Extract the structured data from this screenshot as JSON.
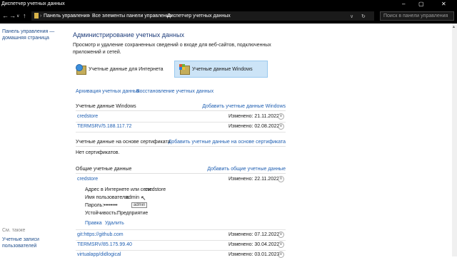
{
  "window": {
    "title": "Диспетчер учетных данных"
  },
  "address": {
    "crumbs": [
      "Панель управления",
      "Все элементы панели управления",
      "Диспетчер учетных данных"
    ],
    "search_placeholder": "Поиск в панели управления"
  },
  "left": {
    "home_line1": "Панель управления —",
    "home_line2": "домашняя страница",
    "see_also": "См. также",
    "user_accounts_line1": "Учетные записи",
    "user_accounts_line2": "пользователей"
  },
  "main": {
    "title": "Администрирование учетных данных",
    "description": "Просмотр и удаление сохраненных сведений о входе для веб-сайтов, подключенных приложений и сетей.",
    "web_creds": "Учетные данные для Интернета",
    "win_creds": "Учетные данные Windows",
    "backup": "Архивация учетных данных",
    "restore": "Восстановление учетных данных",
    "windows_section": {
      "title": "Учетные данные Windows",
      "add": "Добавить учетные данные Windows",
      "items": [
        {
          "name": "credstore",
          "modified": "Изменено:  21.11.2022"
        },
        {
          "name": "TERMSRV/5.188.117.72",
          "modified": "Изменено:  02.08.2022"
        }
      ]
    },
    "cert_section": {
      "title": "Учетные данные на основе сертификата",
      "add": "Добавить учетные данные на основе сертификата",
      "empty": "Нет сертификатов."
    },
    "generic_section": {
      "title": "Общие учетные данные",
      "add": "Добавить общие учетные данные",
      "expanded": {
        "name": "credstore",
        "modified": "Изменено:  22.11.2022",
        "address_label": "Адрес в Интернете или сети:",
        "address_value": "credstore",
        "user_label": "Имя пользователя:",
        "user_value": "admin",
        "password_label": "Пароль:",
        "password_value": "••••••••",
        "persist_label": "Устойчивость:",
        "persist_value": "Предприятие",
        "edit": "Правка",
        "remove": "Удалить",
        "tooltip": "admin"
      },
      "items": [
        {
          "name": "git:https://github.com",
          "modified": "Изменено:  07.12.2022"
        },
        {
          "name": "TERMSRV/85.175.99.40",
          "modified": "Изменено:  30.04.2022"
        },
        {
          "name": "virtualapp/didlogical",
          "modified": "Изменено:  03.01.2023"
        }
      ]
    }
  }
}
